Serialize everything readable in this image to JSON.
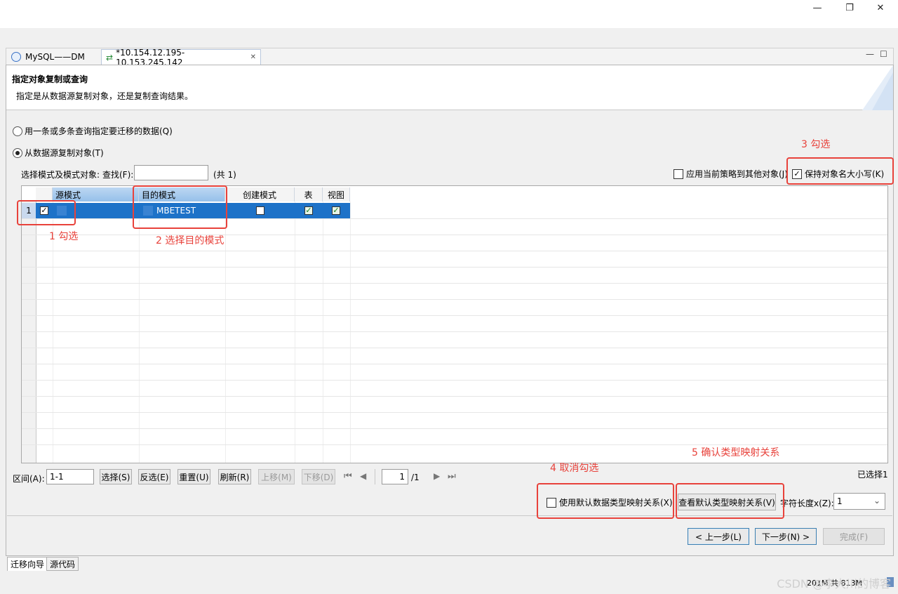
{
  "window": {
    "minimize": "—",
    "restore": "❐",
    "close": "✕"
  },
  "tabs": [
    {
      "label": "MySQL——DM"
    },
    {
      "label": "*10.154.12.195-10.153.245.142",
      "close": "✕"
    }
  ],
  "panel_controls": {
    "minimize": "—",
    "maximize": "☐"
  },
  "header": {
    "title": "指定对象复制或查询",
    "subtitle": "指定是从数据源复制对象，还是复制查询结果。"
  },
  "options": {
    "query_label": "用一条或多条查询指定要迁移的数据(Q)",
    "copy_label": "从数据源复制对象(T)"
  },
  "filter": {
    "label": "选择模式及模式对象:",
    "find_label": "查找(F):",
    "find_value": "",
    "count": "(共 1)"
  },
  "right_options": {
    "apply_policy": "应用当前策略到其他对象(J)",
    "keep_case": "保持对象名大小写(K)"
  },
  "grid": {
    "columns": [
      "源模式",
      "目的模式",
      "创建模式",
      "表",
      "视图"
    ],
    "rows": [
      {
        "num": "1",
        "checked": true,
        "source": "",
        "target": "MBETEST",
        "create": false,
        "table": true,
        "view": true
      }
    ]
  },
  "annotations": {
    "a1": "1 勾选",
    "a2": "2 选择目的模式",
    "a3": "3 勾选",
    "a4": "4 取消勾选",
    "a5": "5 确认类型映射关系"
  },
  "range": {
    "label": "区间(A):",
    "value": "1-1",
    "select": "选择(S)",
    "invert": "反选(E)",
    "reset": "重置(U)",
    "refresh": "刷新(R)",
    "up": "上移(M)",
    "down": "下移(D)",
    "page_value": "1",
    "page_total": "/1",
    "selected": "已选择1"
  },
  "mapping": {
    "use_default": "使用默认数据类型映射关系(X)",
    "view_default": "查看默认类型映射关系(V)",
    "char_len_label": "字符长度x(Z):",
    "char_len_value": "1"
  },
  "nav": {
    "prev": "< 上一步(L)",
    "next": "下一步(N) >",
    "finish": "完成(F)"
  },
  "bottom_tabs": [
    "迁移向导",
    "源代码"
  ],
  "status": {
    "memory": "201M 共 813M",
    "watermark": "CSDN @李大川的博客"
  }
}
